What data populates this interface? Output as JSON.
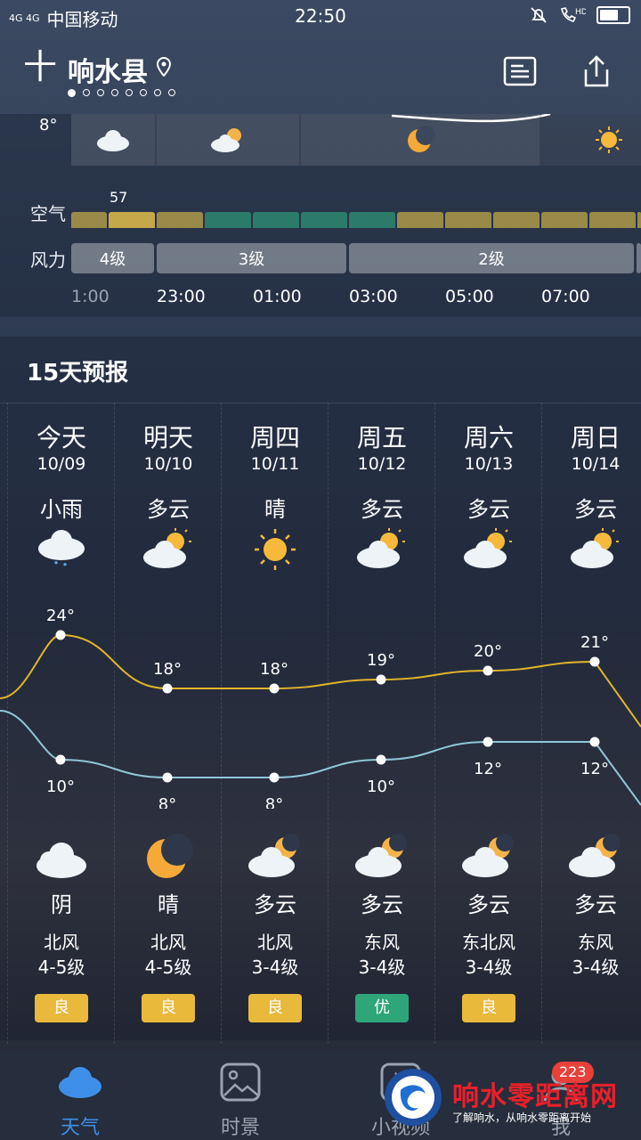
{
  "status": {
    "network": "4G 4G",
    "carrier": "中国移动",
    "time": "22:50",
    "hd": "HD"
  },
  "header": {
    "city": "响水县",
    "page_count": 8,
    "active_page": 0
  },
  "hourly": {
    "top_temp": "8°",
    "air_label": "空气",
    "air_value": "57",
    "wind_label": "风力",
    "wind_levels": [
      "4级",
      "3级",
      "2级"
    ],
    "times": [
      "1:00",
      "23:00",
      "01:00",
      "03:00",
      "05:00",
      "07:00"
    ]
  },
  "forecast": {
    "title": "15天预报",
    "days": [
      {
        "weekday": "今天",
        "date": "10/09",
        "day_weather": "小雨",
        "high": "24°",
        "low": "10°",
        "night_weather": "阴",
        "wind_dir": "北风",
        "wind_level": "4-5级",
        "aqi": "良",
        "aqi_color": "#e9b93b",
        "day_icon": "rain-cloud-icon",
        "night_icon": "cloud-icon"
      },
      {
        "weekday": "明天",
        "date": "10/10",
        "day_weather": "多云",
        "high": "18°",
        "low": "8°",
        "night_weather": "晴",
        "wind_dir": "北风",
        "wind_level": "4-5级",
        "aqi": "良",
        "aqi_color": "#e9b93b",
        "day_icon": "partly-cloudy-icon",
        "night_icon": "moon-icon"
      },
      {
        "weekday": "周四",
        "date": "10/11",
        "day_weather": "晴",
        "high": "18°",
        "low": "8°",
        "night_weather": "多云",
        "wind_dir": "北风",
        "wind_level": "3-4级",
        "aqi": "良",
        "aqi_color": "#e9b93b",
        "day_icon": "sun-icon",
        "night_icon": "cloudy-night-icon"
      },
      {
        "weekday": "周五",
        "date": "10/12",
        "day_weather": "多云",
        "high": "19°",
        "low": "10°",
        "night_weather": "多云",
        "wind_dir": "东风",
        "wind_level": "3-4级",
        "aqi": "优",
        "aqi_color": "#2fa57a",
        "day_icon": "partly-cloudy-icon",
        "night_icon": "cloudy-night-icon"
      },
      {
        "weekday": "周六",
        "date": "10/13",
        "day_weather": "多云",
        "high": "20°",
        "low": "12°",
        "night_weather": "多云",
        "wind_dir": "东北风",
        "wind_level": "3-4级",
        "aqi": "良",
        "aqi_color": "#e9b93b",
        "day_icon": "partly-cloudy-icon",
        "night_icon": "cloudy-night-icon"
      },
      {
        "weekday": "周日",
        "date": "10/14",
        "day_weather": "多云",
        "high": "21°",
        "low": "12°",
        "night_weather": "多云",
        "wind_dir": "东风",
        "wind_level": "3-4级",
        "aqi": "",
        "aqi_color": "",
        "day_icon": "partly-cloudy-icon",
        "night_icon": "cloudy-night-icon"
      }
    ]
  },
  "tabs": [
    {
      "label": "天气",
      "icon": "cloud-icon",
      "active": true
    },
    {
      "label": "时景",
      "icon": "image-icon",
      "active": false
    },
    {
      "label": "小视频",
      "icon": "video-icon",
      "active": false
    },
    {
      "label": "我",
      "icon": "profile-icon",
      "active": false
    }
  ],
  "badge": "223",
  "watermark": {
    "title": "响水零距离网",
    "subtitle": "了解响水，从响水零距离开始"
  },
  "colors": {
    "accent": "#3e8fe8",
    "high_line": "#e3b52a",
    "low_line": "#8fc7d8",
    "aqi_good": "#e9b93b",
    "aqi_excellent": "#2fa57a"
  }
}
